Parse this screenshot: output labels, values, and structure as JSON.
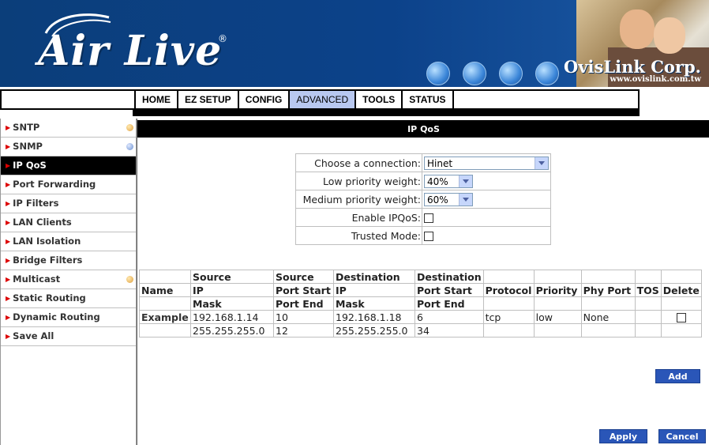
{
  "banner": {
    "logo_text": "Air Live",
    "logo_mark": "®",
    "brand_name": "OvisLink Corp.",
    "brand_url": "www.ovislink.com.tw"
  },
  "nav": {
    "tabs": [
      "HOME",
      "EZ SETUP",
      "CONFIG",
      "ADVANCED",
      "TOOLS",
      "STATUS"
    ],
    "active": "ADVANCED"
  },
  "sidebar": {
    "items": [
      "SNTP",
      "SNMP",
      "IP QoS",
      "Port Forwarding",
      "IP Filters",
      "LAN Clients",
      "LAN Isolation",
      "Bridge Filters",
      "Multicast",
      "Static Routing",
      "Dynamic Routing",
      "Save All"
    ],
    "active": "IP QoS"
  },
  "page": {
    "title": "IP QoS"
  },
  "config": {
    "connection_label": "Choose a connection:",
    "connection_value": "Hinet",
    "low_label": "Low priority weight:",
    "low_value": "40%",
    "medium_label": "Medium priority weight:",
    "medium_value": "60%",
    "enable_label": "Enable IPQoS:",
    "trusted_label": "Trusted Mode:"
  },
  "table": {
    "h_name": "Name",
    "h_src_ip": "Source",
    "h_src_ip2": "IP",
    "h_src_ip3": "Mask",
    "h_src_port": "Source",
    "h_src_port2": "Port Start",
    "h_src_port3": "Port End",
    "h_dst_ip": "Destination",
    "h_dst_ip2": "IP",
    "h_dst_ip3": "Mask",
    "h_dst_port": "Destination",
    "h_dst_port2": "Port Start",
    "h_dst_port3": "Port End",
    "h_protocol": "Protocol",
    "h_priority": "Priority",
    "h_phy": "Phy Port",
    "h_tos": "TOS",
    "h_delete": "Delete",
    "example": {
      "name": "Example",
      "src_ip": "192.168.1.14",
      "src_mask": "255.255.255.0",
      "src_port_start": "10",
      "src_port_end": "12",
      "dst_ip": "192.168.1.18",
      "dst_mask": "255.255.255.0",
      "dst_port_start": "6",
      "dst_port_end": "34",
      "protocol": "tcp",
      "priority": "low",
      "phy_port": "None"
    }
  },
  "buttons": {
    "add": "Add",
    "apply": "Apply",
    "cancel": "Cancel"
  }
}
